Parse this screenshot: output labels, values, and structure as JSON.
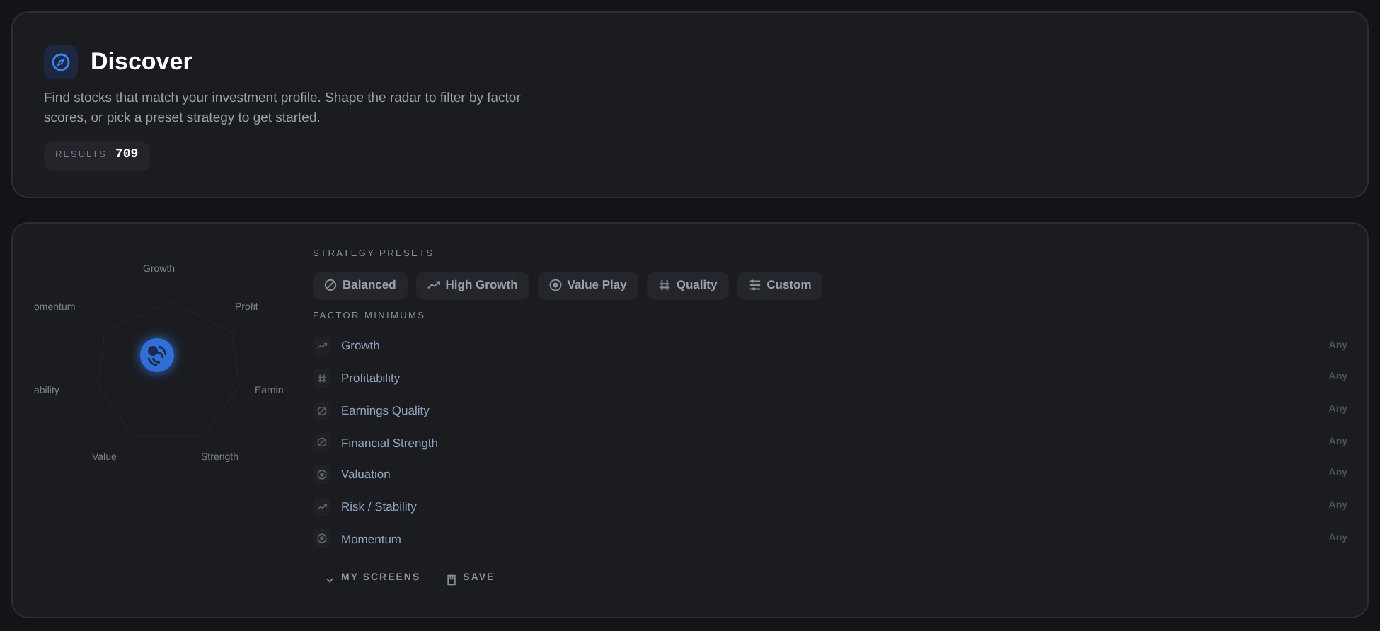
{
  "header": {
    "title": "Discover",
    "description": "Find stocks that match your investment profile. Shape the radar to filter by factor scores, or pick a preset strategy to get started.",
    "results_label": "RESULTS",
    "results_count": "709"
  },
  "radar": {
    "labels": [
      "Growth",
      "Profit",
      "Earnin",
      "Strength",
      "Value",
      "ability",
      "omentum"
    ]
  },
  "presets_heading": "STRATEGY PRESETS",
  "presets": [
    {
      "label": "Balanced"
    },
    {
      "label": "High Growth"
    },
    {
      "label": "Value Play"
    },
    {
      "label": "Quality"
    },
    {
      "label": "Custom"
    }
  ],
  "factors_heading": "FACTOR MINIMUMS",
  "factors": [
    {
      "name": "Growth",
      "value": "Any"
    },
    {
      "name": "Profitability",
      "value": "Any"
    },
    {
      "name": "Earnings Quality",
      "value": "Any"
    },
    {
      "name": "Financial Strength",
      "value": "Any"
    },
    {
      "name": "Valuation",
      "value": "Any"
    },
    {
      "name": "Risk / Stability",
      "value": "Any"
    },
    {
      "name": "Momentum",
      "value": "Any"
    }
  ],
  "footer_buttons": [
    {
      "label": "MY SCREENS"
    },
    {
      "label": "SAVE"
    }
  ]
}
